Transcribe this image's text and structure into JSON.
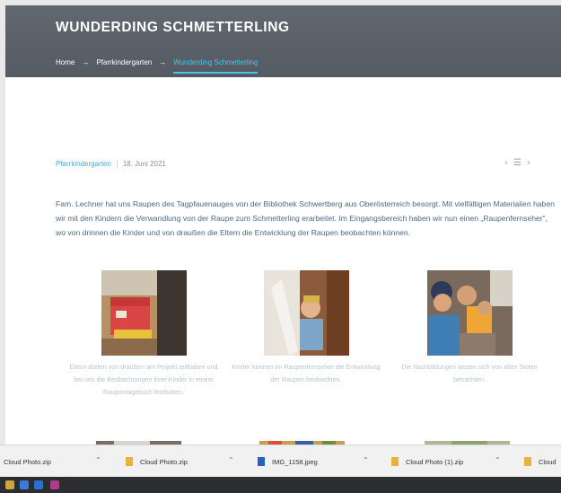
{
  "page": {
    "title": "WUNDERDING SCHMETTERLING",
    "breadcrumb": [
      "Home",
      "Pfarrkindergarten",
      "Wunderding Schmetterling"
    ],
    "breadcrumb_separator": "→"
  },
  "post": {
    "category": "Pfarrkindergarten",
    "date": "18. Juni 2021",
    "nav": {
      "prev": "‹",
      "list": "☰",
      "next": "›"
    },
    "body": "Fam. Lechner hat uns Raupen des Tagpfauenauges von der Bibliothek Schwertberg aus Oberösterreich besorgt. Mit vielfältigen Materialien haben wir mit den Kindern die Verwandlung von der Raupe zum Schmetterling erarbeitet. Im Eingangsbereich haben wir nun einen „Raupenfernseher“, wo von drinnen die Kinder und von draußen die Eltern die Entwicklung der Raupen beobachten können."
  },
  "gallery": [
    {
      "caption": "Eltern dürfen von draußen am Projekt teilhaben und bei uns die Beobachtungen ihrer Kinder in einem Raupentagebuch festhalten."
    },
    {
      "caption": "Kinder können im Raupenfernseher die Entwicklung der Raupen beobachten."
    },
    {
      "caption": "Die Nachbildungen lassen sich von allen Seiten betrachten."
    }
  ],
  "downloads": [
    {
      "name": "Cloud Photo.zip"
    },
    {
      "name": "Cloud Photo.zip"
    },
    {
      "name": "IMG_1158.jpeg"
    },
    {
      "name": "Cloud Photo (1).zip"
    },
    {
      "name": "Cloud"
    }
  ],
  "colors": {
    "accent": "#4cc3e6",
    "hero_bg": "#5b6168",
    "body_text": "#4b6a8a",
    "caption_text": "#b7c4cf"
  }
}
